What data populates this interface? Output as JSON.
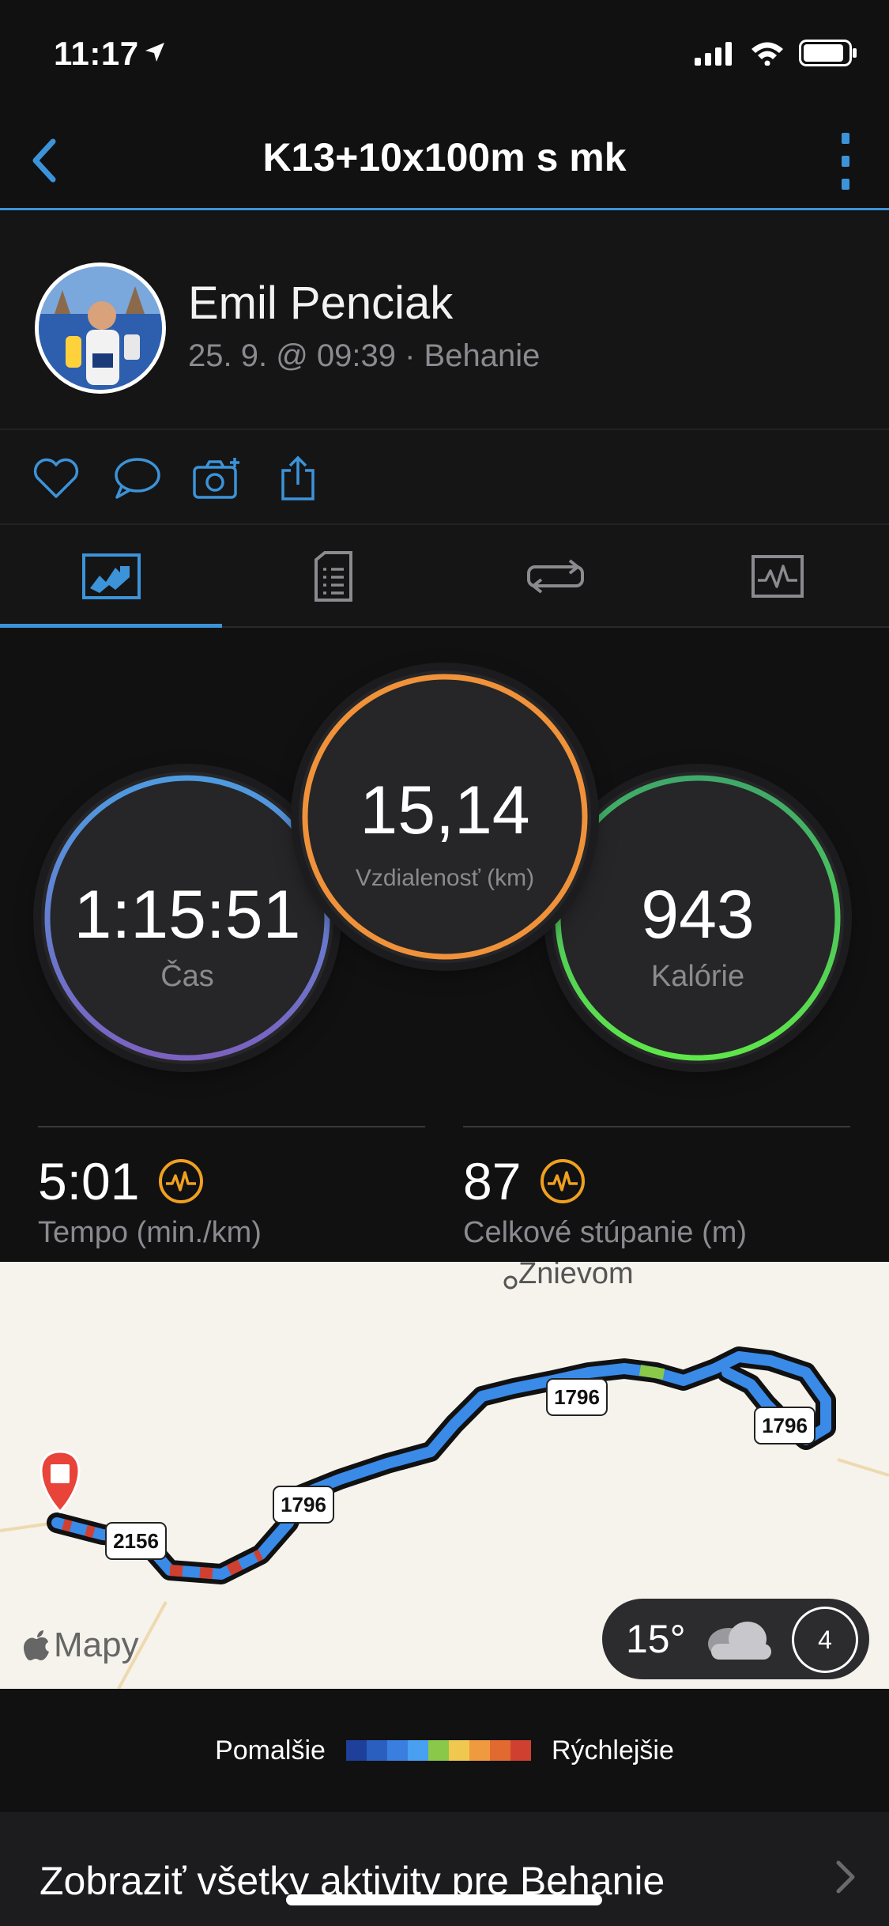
{
  "status_bar": {
    "time": "11:17"
  },
  "nav": {
    "title": "K13+10x100m s mk"
  },
  "profile": {
    "name": "Emil Penciak",
    "meta": "25. 9. @ 09:39 · Behanie"
  },
  "actions": [
    "heart-icon",
    "comment-icon",
    "add-photo-icon",
    "share-icon"
  ],
  "tabs": [
    {
      "name": "overview",
      "active": true
    },
    {
      "name": "details",
      "active": false
    },
    {
      "name": "laps",
      "active": false
    },
    {
      "name": "charts",
      "active": false
    }
  ],
  "rings": {
    "time": {
      "value": "1:15:51",
      "label": "Čas",
      "color": "#5b8fd6"
    },
    "distance": {
      "value": "15,14",
      "label": "Vzdialenosť (km)",
      "color": "#f0923a"
    },
    "calories": {
      "value": "943",
      "label": "Kalórie",
      "color": "#4fd65a"
    }
  },
  "metrics": {
    "pace": {
      "value": "5:01",
      "label": "Tempo (min./km)"
    },
    "elevation": {
      "value": "87",
      "label": "Celkové stúpanie (m)"
    }
  },
  "map": {
    "place": "Znievom",
    "roads": [
      "1796",
      "1796",
      "1796",
      "2156"
    ],
    "temperature": "15°",
    "wind": "4",
    "brand": "Mapy"
  },
  "legend": {
    "slower": "Pomalšie",
    "faster": "Rýchlejšie",
    "colors": [
      "#1e3f9a",
      "#2a5fc0",
      "#3a7fe0",
      "#4aa0f0",
      "#8ac84a",
      "#f0c850",
      "#f09a40",
      "#e06a30",
      "#d04030"
    ]
  },
  "footer": {
    "text": "Zobraziť všetky aktivity pre Behanie"
  }
}
